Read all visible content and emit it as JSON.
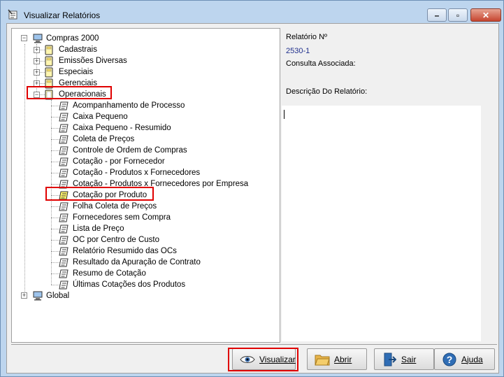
{
  "window": {
    "title": "Visualizar Relatórios"
  },
  "tree": {
    "root": "Compras 2000",
    "folders": [
      "Cadastrais",
      "Emissões Diversas",
      "Especiais",
      "Gerenciais",
      "Operacionais"
    ],
    "reports": [
      "Acompanhamento de Processo",
      "Caixa Pequeno",
      "Caixa Pequeno - Resumido",
      "Coleta de Preços",
      "Controle de Ordem de Compras",
      "Cotação - por Fornecedor",
      "Cotação - Produtos x Fornecedores",
      "Cotação - Produtos x Fornecedores por Empresa",
      "Cotação por Produto",
      "Folha Coleta de Preços",
      "Fornecedores sem Compra",
      "Lista de Preço",
      "OC por Centro de Custo",
      "Relatório Resumido das OCs",
      "Resultado da Apuração de Contrato",
      "Resumo de Cotação",
      "Últimas Cotações dos Produtos"
    ],
    "second_root": "Global",
    "selected": "Cotação por Produto"
  },
  "details": {
    "report_no_label": "Relatório Nº",
    "report_no_value": "2530-1",
    "query_label": "Consulta Associada:",
    "description_label": "Descrição Do Relatório:"
  },
  "buttons": {
    "visualizar": "Visualizar",
    "abrir": "Abrir",
    "sair": "Sair",
    "ajuda": "Ajuda"
  },
  "colors": {
    "highlight": "#e00000",
    "value_blue": "#1f2f8c",
    "title_bar": "#bdd5ee"
  }
}
